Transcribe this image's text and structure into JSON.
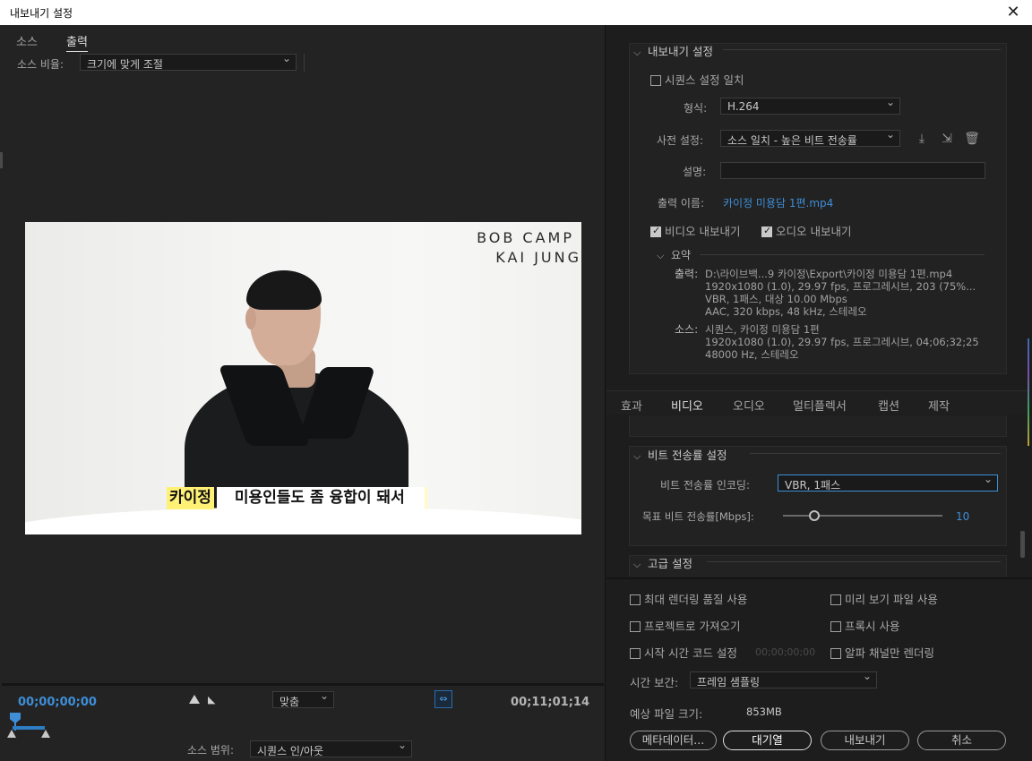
{
  "window": {
    "title": "내보내기 설정",
    "close_glyph": "✕"
  },
  "left": {
    "tabs": [
      "소스",
      "출력"
    ],
    "active_tab": "출력",
    "source_ratio_label": "소스 비율:",
    "source_ratio_value": "크기에 맞게 조절",
    "preview": {
      "brand_line1": "BOB CAMP",
      "brand_line2": "KAI JUNG",
      "subtitle_name": "카이정",
      "subtitle_text": "미용인들도 좀 융합이 돼서"
    },
    "timecode_start": "00;00;00;00",
    "timecode_end": "00;11;01;14",
    "fit_value": "맞춤",
    "source_range_label": "소스 범위:",
    "source_range_value": "시퀀스 인/아웃"
  },
  "export_settings": {
    "section_title": "내보내기 설정",
    "match_sequence_label": "시퀀스 설정 일치",
    "match_sequence_checked": false,
    "format_label": "형식:",
    "format_value": "H.264",
    "preset_label": "사전 설정:",
    "preset_value": "소스 일치 - 높은 비트 전송률",
    "comment_label": "설명:",
    "comment_value": "",
    "output_name_label": "출력 이름:",
    "output_name_value": "카이정 미용담 1편.mp4",
    "export_video_label": "비디오 내보내기",
    "export_video_checked": true,
    "export_audio_label": "오디오 내보내기",
    "export_audio_checked": true,
    "summary_title": "요약",
    "summary_output_label": "출력:",
    "summary_output_lines": [
      "D:\\라이브백...9 카이정\\Export\\카이정 미용담 1편.mp4",
      "1920x1080 (1.0), 29.97 fps, 프로그레시브, 203 (75%...",
      "VBR, 1패스, 대상 10.00 Mbps",
      "AAC, 320 kbps, 48 kHz, 스테레오"
    ],
    "summary_source_label": "소스:",
    "summary_source_lines": [
      "시퀀스, 카이정 미용담 1편",
      "1920x1080 (1.0), 29.97 fps, 프로그레시브, 04;06;32;25",
      "48000 Hz, 스테레오"
    ]
  },
  "tabs": {
    "items": [
      "효과",
      "비디오",
      "오디오",
      "멀티플렉서",
      "캡션",
      "제작"
    ],
    "active": "비디오"
  },
  "bitrate": {
    "section_title": "비트 전송률 설정",
    "encoding_label": "비트 전송률 인코딩:",
    "encoding_value": "VBR, 1패스",
    "target_label": "목표 비트 전송률[Mbps]:",
    "target_value": "10",
    "advanced_title": "고급 설정"
  },
  "options": {
    "max_render_quality": "최대 렌더링 품질 사용",
    "use_previews": "미리 보기 파일 사용",
    "import_into_project": "프로젝트로 가져오기",
    "use_proxies": "프록시 사용",
    "set_start_timecode": "시작 시간 코드 설정",
    "start_timecode_value": "00;00;00;00",
    "render_alpha_only": "알파 채널만 렌더링",
    "time_interpolation_label": "시간 보간:",
    "time_interpolation_value": "프레임 샘플링",
    "estimated_size_label": "예상 파일 크기:",
    "estimated_size_value": "853MB"
  },
  "buttons": {
    "metadata": "메타데이터...",
    "queue": "대기열",
    "export": "내보내기",
    "cancel": "취소"
  },
  "colors": {
    "accent": "#3e8ed8",
    "background": "#1d1d1d",
    "subtitle_highlight": "#fff176"
  }
}
